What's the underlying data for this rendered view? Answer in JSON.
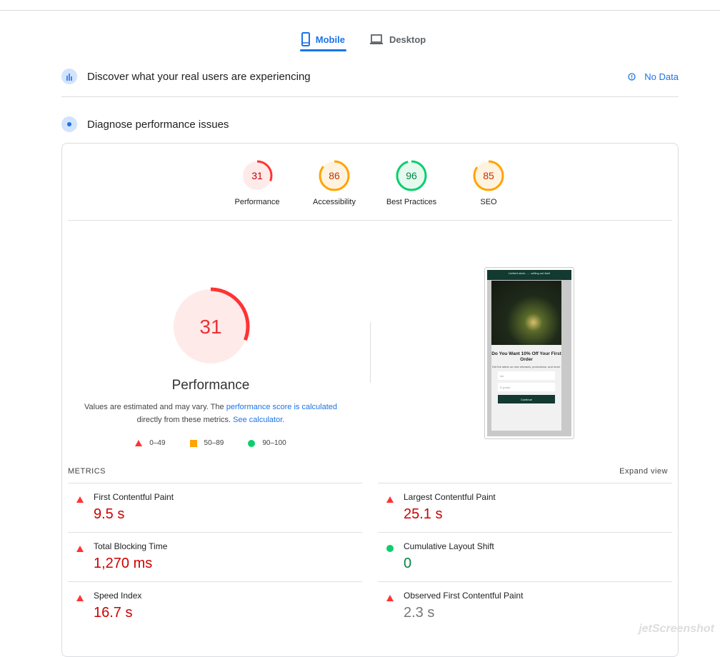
{
  "tabs": [
    {
      "label": "Mobile",
      "icon": "phone-icon",
      "active": true
    },
    {
      "label": "Desktop",
      "icon": "laptop-icon",
      "active": false
    }
  ],
  "field": {
    "title": "Discover what your real users are experiencing",
    "status": "No Data"
  },
  "lab": {
    "title": "Diagnose performance issues"
  },
  "categories": [
    {
      "label": "Performance",
      "score": 31,
      "color": "#ff3333",
      "bg": "#ffeaea",
      "text": "#c00"
    },
    {
      "label": "Accessibility",
      "score": 86,
      "color": "#ffa400",
      "bg": "#fff3e0",
      "text": "#c33300"
    },
    {
      "label": "Best Practices",
      "score": 96,
      "color": "#0cce6b",
      "bg": "#e6f9ef",
      "text": "#018642"
    },
    {
      "label": "SEO",
      "score": 85,
      "color": "#ffa400",
      "bg": "#fff3e0",
      "text": "#c33300"
    }
  ],
  "main": {
    "score": 31,
    "label": "Performance",
    "note1": "Values are estimated and may vary. The ",
    "link1": "performance score is calculated",
    "note2": "directly from these metrics. ",
    "link2": "See calculator",
    "note3": "."
  },
  "legend": [
    "0–49",
    "50–89",
    "90–100"
  ],
  "screenshot": {
    "banner": "Limited stock - ... selling out fast!",
    "headline": "Do You Want 10% Off Your First Order",
    "sub": "Get the latest on new releases, promotions, and more.",
    "field1": "Ad",
    "field2": "E-posta",
    "button": "Continue"
  },
  "metrics_header": {
    "title": "METRICS",
    "expand": "Expand view"
  },
  "metrics": [
    {
      "name": "First Contentful Paint",
      "value": "9.5 s",
      "status": "fail"
    },
    {
      "name": "Largest Contentful Paint",
      "value": "25.1 s",
      "status": "fail"
    },
    {
      "name": "Total Blocking Time",
      "value": "1,270 ms",
      "status": "fail"
    },
    {
      "name": "Cumulative Layout Shift",
      "value": "0",
      "status": "pass"
    },
    {
      "name": "Speed Index",
      "value": "16.7 s",
      "status": "fail"
    },
    {
      "name": "Observed First Contentful Paint",
      "value": "2.3 s",
      "status": "info"
    }
  ],
  "watermark": "jetScreenshot"
}
